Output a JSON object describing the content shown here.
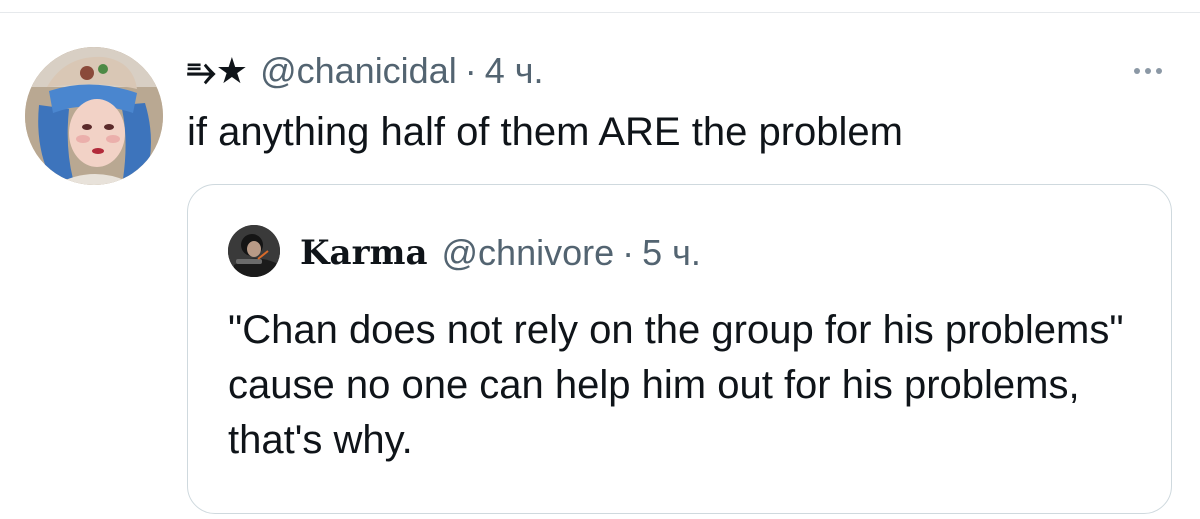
{
  "tweet": {
    "display_name": "⥱★",
    "username": "@chanicidal",
    "separator": "·",
    "time": "4 ч.",
    "text": "if anything half of them ARE the problem",
    "more_icon": "more-horizontal-icon"
  },
  "quoted_tweet": {
    "display_name": "Karma",
    "username": "@chnivore",
    "separator": "·",
    "time": "5 ч.",
    "text": "\"Chan does not rely on the group for his problems\" cause no one can help him out for his problems, that's why."
  },
  "colors": {
    "text_primary": "#0f1419",
    "text_secondary": "#536471",
    "border": "#cfd9de",
    "avatar_hair": "#4a7fc0"
  }
}
